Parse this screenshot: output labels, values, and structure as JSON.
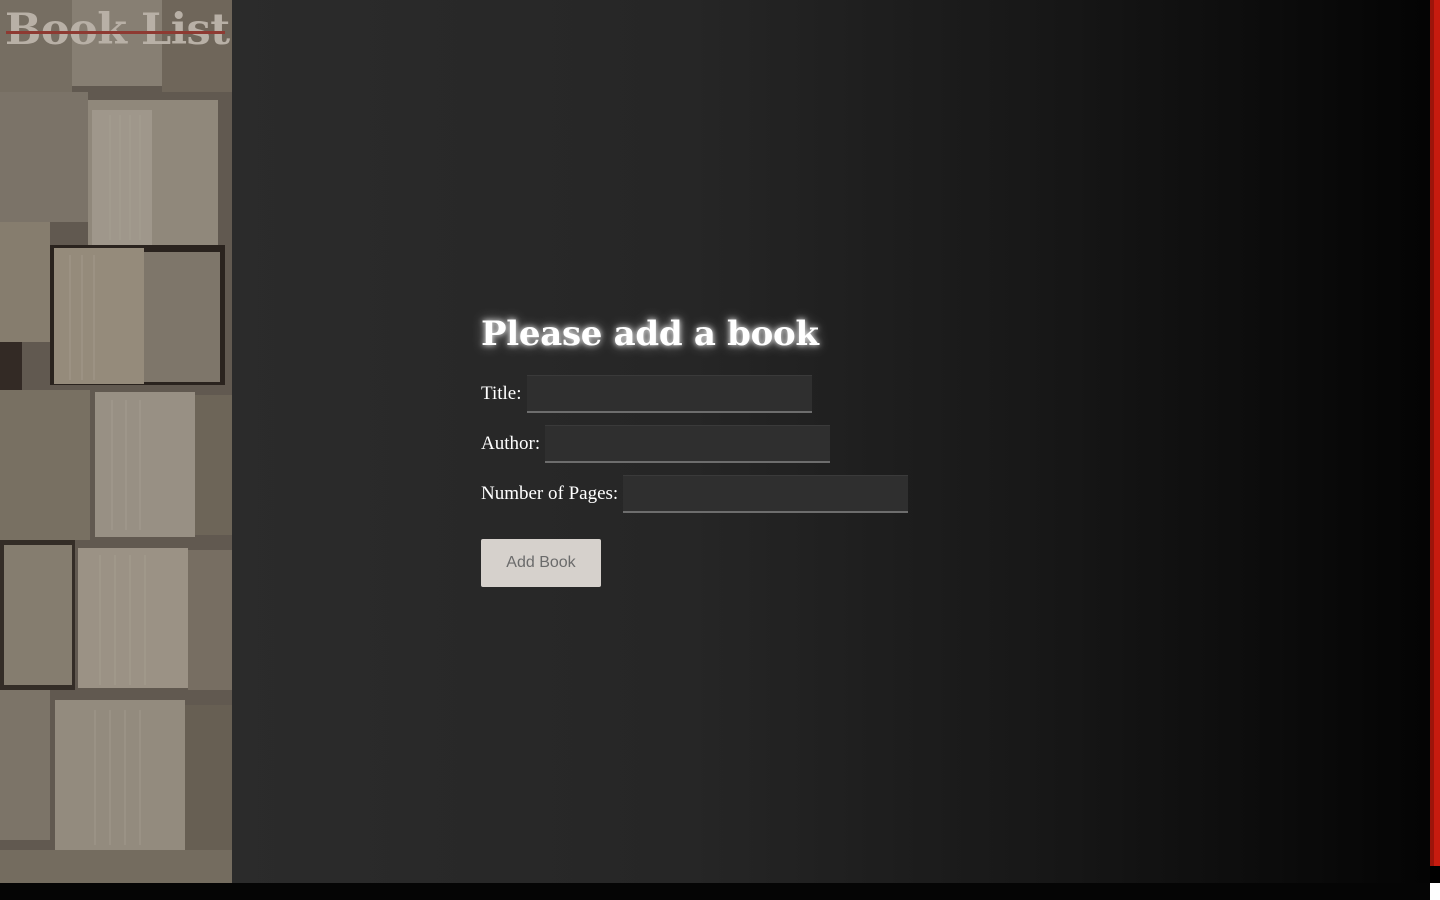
{
  "sidebar": {
    "title": "Book List"
  },
  "form": {
    "heading": "Please add a book",
    "fields": [
      {
        "label": "Title:",
        "value": "",
        "placeholder": ""
      },
      {
        "label": "Author:",
        "value": "",
        "placeholder": ""
      },
      {
        "label": "Number of Pages:",
        "value": "",
        "placeholder": ""
      }
    ],
    "submit_label": "Add Book"
  },
  "colors": {
    "background": "#2b2b2b",
    "accent": "#c71b0f",
    "button": "#d6d1cc",
    "title_strike": "#8e3a32"
  },
  "icons": {
    "sidebar_image": "open-books-photo"
  }
}
